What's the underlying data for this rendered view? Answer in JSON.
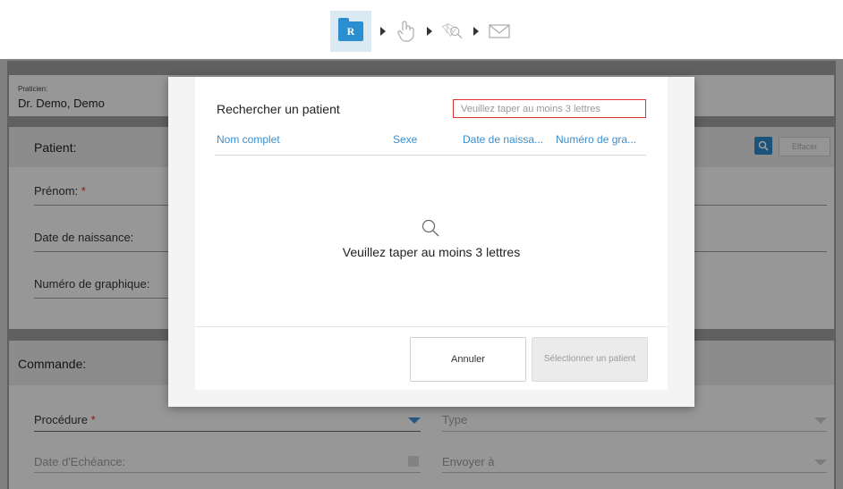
{
  "workflow": {
    "steps": [
      {
        "icon": "folder-r-icon",
        "label": "R"
      },
      {
        "icon": "hand-scan-icon"
      },
      {
        "icon": "magnifier-model-icon"
      },
      {
        "icon": "envelope-icon"
      }
    ]
  },
  "praticien": {
    "label": "Praticien:",
    "value": "Dr. Demo, Demo"
  },
  "patient": {
    "title": "Patient:",
    "clear_label": "Effacer",
    "fields": {
      "prenom": "Prénom:",
      "date_naissance": "Date de naissance:",
      "numero": "Numéro de graphique:"
    },
    "required_mark": "*"
  },
  "commande": {
    "title": "Commande:",
    "procedure": "Procédure",
    "type": "Type",
    "date_echeance": "Date d'Echéance:",
    "envoyer": "Envoyer à"
  },
  "modal": {
    "title": "Rechercher un patient",
    "search_placeholder": "Veuillez taper au moins 3 lettres",
    "columns": [
      "Nom complet",
      "Sexe",
      "Date de naissa...",
      "Numéro de gra..."
    ],
    "empty_message": "Veuillez taper au moins 3 lettres",
    "cancel_label": "Annuler",
    "select_label": "Sélectionner un patient"
  },
  "colors": {
    "accent": "#2c86c5",
    "required": "#e02a2a",
    "error_border": "#dd3333"
  }
}
